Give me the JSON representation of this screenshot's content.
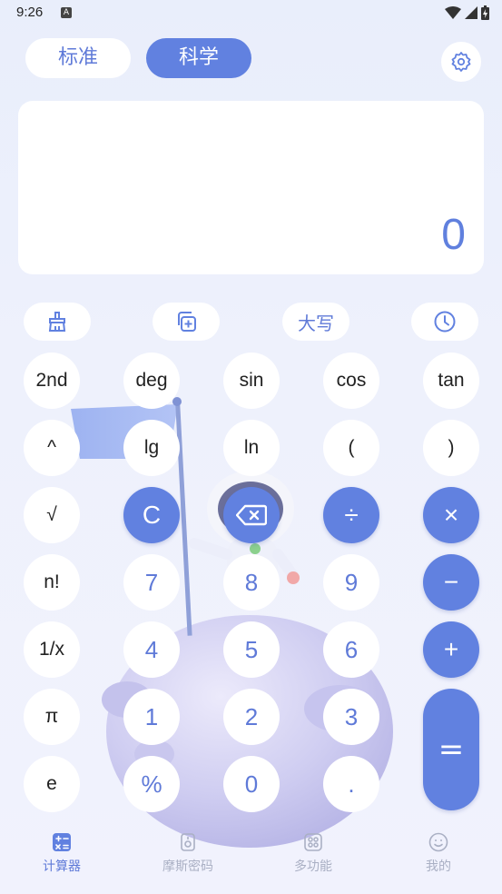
{
  "status": {
    "time": "9:26",
    "notif_letter": "A"
  },
  "modes": [
    {
      "label": "标准"
    },
    {
      "label": "科学"
    }
  ],
  "selected_mode": "科学",
  "display": {
    "value": "0"
  },
  "tools": [
    {
      "icon": "broom-icon"
    },
    {
      "icon": "copy-add-icon"
    },
    {
      "label": "大写"
    },
    {
      "icon": "history-clock-icon"
    }
  ],
  "keys": {
    "r1": [
      "2nd",
      "deg",
      "sin",
      "cos",
      "tan"
    ],
    "r2": [
      "^",
      "lg",
      "ln",
      "(",
      ")"
    ],
    "r3": [
      "√",
      "C",
      "⌫",
      "÷",
      "×"
    ],
    "r4": [
      "n!",
      "7",
      "8",
      "9",
      "−"
    ],
    "r5": [
      "1/x",
      "4",
      "5",
      "6",
      "+"
    ],
    "r6": [
      "π",
      "1",
      "2",
      "3"
    ],
    "r7": [
      "e",
      "%",
      "0",
      "."
    ],
    "equals": "="
  },
  "nav": [
    {
      "label": "计算器",
      "icon": "calculator-icon",
      "active": true
    },
    {
      "label": "摩斯密码",
      "icon": "morse-lock-icon",
      "active": false
    },
    {
      "label": "多功能",
      "icon": "grid-apps-icon",
      "active": false
    },
    {
      "label": "我的",
      "icon": "smiley-icon",
      "active": false
    }
  ],
  "colors": {
    "accent": "#6181e0",
    "text_dark": "#222222",
    "nav_inactive": "#aab0c4"
  }
}
